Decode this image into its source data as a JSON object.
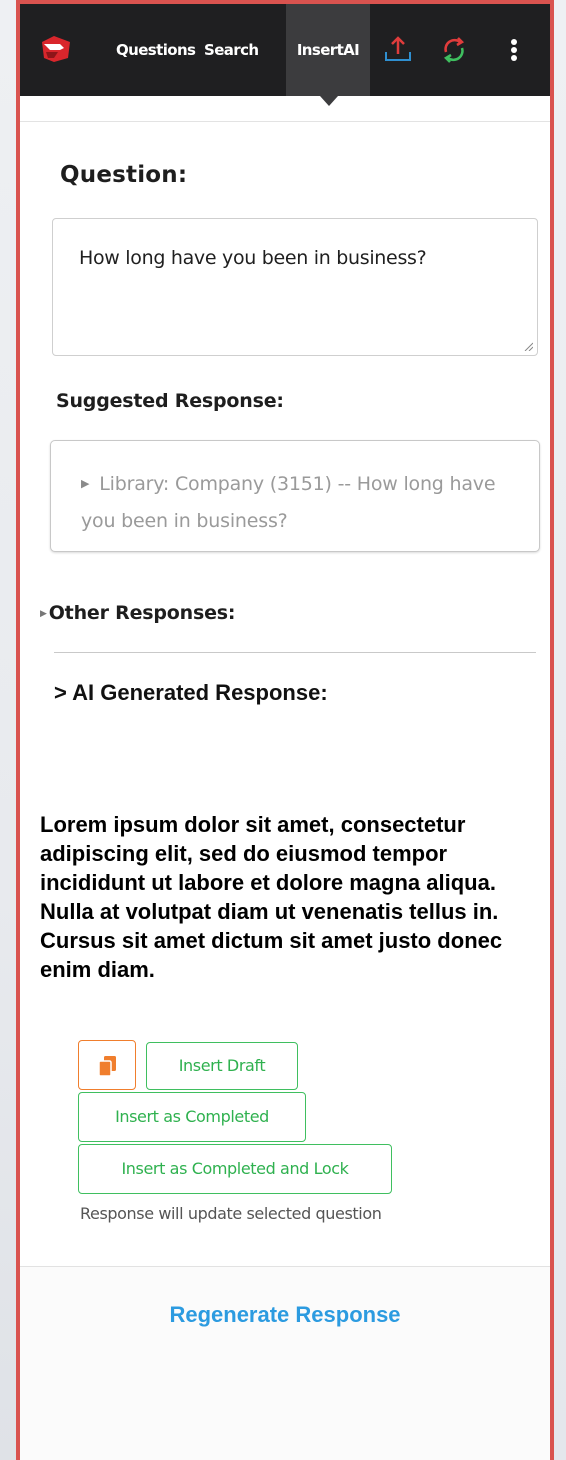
{
  "nav": {
    "items": [
      "Questions",
      "Search",
      "InsertAI"
    ],
    "active": "InsertAI",
    "icons": [
      "upload-icon",
      "refresh-icon",
      "more-vertical-icon"
    ]
  },
  "question": {
    "heading": "Question:",
    "text": "How long have you been in business?"
  },
  "suggested": {
    "heading": "Suggested Response:",
    "text": "Library: Company (3151) -- How long have you been in business?"
  },
  "other": {
    "heading": "Other Responses:"
  },
  "ai": {
    "heading": "> AI Generated Response:",
    "body": "Lorem ipsum dolor sit amet, consectetur adipiscing elit, sed do eiusmod tempor incididunt ut labore et dolore magna aliqua. Nulla at volutpat diam ut venenatis tellus in. Cursus sit amet dictum sit amet justo donec enim diam."
  },
  "actions": {
    "copy_icon": "copy-icon",
    "insert_draft": "Insert Draft",
    "insert_completed": "Insert as Completed",
    "insert_completed_lock": "Insert as Completed and Lock",
    "note": "Response will update selected question"
  },
  "footer": {
    "regenerate": "Regenerate Response"
  },
  "colors": {
    "border_red": "#d9534f",
    "green": "#3fbf5f",
    "orange": "#f07e2d",
    "blue": "#2c9be0",
    "topbar": "#1f1f21"
  }
}
